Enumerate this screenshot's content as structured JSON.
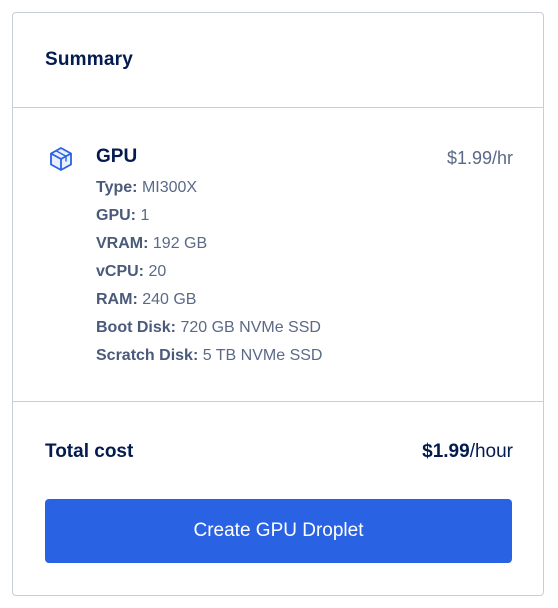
{
  "summary": {
    "title": "Summary"
  },
  "item": {
    "icon": "cube-icon",
    "title": "GPU",
    "price": "$1.99/hr",
    "specs": [
      {
        "key": "Type:",
        "value": "MI300X"
      },
      {
        "key": "GPU:",
        "value": "1"
      },
      {
        "key": "VRAM:",
        "value": "192 GB"
      },
      {
        "key": "vCPU:",
        "value": "20"
      },
      {
        "key": "RAM:",
        "value": "240 GB"
      },
      {
        "key": "Boot Disk:",
        "value": "720 GB NVMe SSD"
      },
      {
        "key": "Scratch Disk:",
        "value": "5 TB NVMe SSD"
      }
    ]
  },
  "total": {
    "label": "Total cost",
    "amount": "$1.99",
    "unit": "/hour"
  },
  "actions": {
    "create_label": "Create GPU Droplet"
  },
  "colors": {
    "accent": "#2a62e4",
    "text_primary": "#031b4e",
    "text_secondary": "#5b6987",
    "border": "#c9ced6",
    "icon": "#2a62e4"
  }
}
